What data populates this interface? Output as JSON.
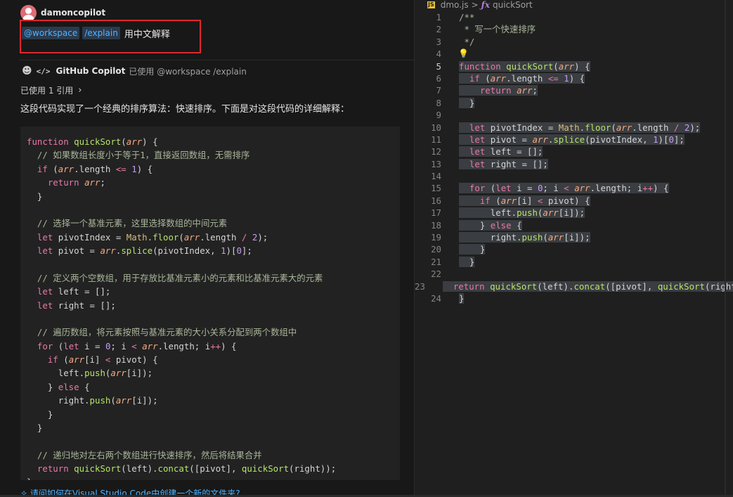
{
  "chat": {
    "user": {
      "name": "damoncopilot"
    },
    "message": {
      "agent": "@workspace",
      "command": "/explain",
      "text": "用中文解释"
    },
    "response": {
      "bot_name": "GitHub Copilot",
      "used": "已使用 @workspace /explain",
      "references": "已使用 1 引用",
      "intro": "这段代码实现了一个经典的排序算法：快速排序。下面是对这段代码的详细解释：",
      "code": [
        "function quickSort(arr) {",
        "  // 如果数组长度小于等于1，直接返回数组，无需排序",
        "  if (arr.length <= 1) {",
        "    return arr;",
        "  }",
        "",
        "  // 选择一个基准元素，这里选择数组的中间元素",
        "  let pivotIndex = Math.floor(arr.length / 2);",
        "  let pivot = arr.splice(pivotIndex, 1)[0];",
        "",
        "  // 定义两个空数组，用于存放比基准元素小的元素和比基准元素大的元素",
        "  let left = [];",
        "  let right = [];",
        "",
        "  // 遍历数组，将元素按照与基准元素的大小关系分配到两个数组中",
        "  for (let i = 0; i < arr.length; i++) {",
        "    if (arr[i] < pivot) {",
        "      left.push(arr[i]);",
        "    } else {",
        "      right.push(arr[i]);",
        "    }",
        "  }",
        "",
        "  // 递归地对左右两个数组进行快速排序，然后将结果合并",
        "  return quickSort(left).concat([pivot], quickSort(right));",
        "}"
      ]
    },
    "followup": "✧ 请问如何在Visual Studio Code中创建一个新的文件夹?"
  },
  "editor": {
    "breadcrumb": {
      "lang_badge": "JS",
      "file": "dmo.js",
      "separator": ">",
      "symbol_icon": "ƒx",
      "symbol": "quickSort"
    },
    "current_line": 5,
    "lines": [
      "/**",
      " * 写一个快速排序",
      " */",
      "",
      "function quickSort(arr) {",
      "  if (arr.length <= 1) {",
      "    return arr;",
      "  }",
      "",
      "  let pivotIndex = Math.floor(arr.length / 2);",
      "  let pivot = arr.splice(pivotIndex, 1)[0];",
      "  let left = [];",
      "  let right = [];",
      "",
      "  for (let i = 0; i < arr.length; i++) {",
      "    if (arr[i] < pivot) {",
      "      left.push(arr[i]);",
      "    } else {",
      "      right.push(arr[i]);",
      "    }",
      "  }",
      "",
      "  return quickSort(left).concat([pivot], quickSort(right));",
      "}"
    ]
  },
  "colors": {
    "highlight_border": "#e0262d",
    "chip_text": "#4fb3ff",
    "keyword": "#e879a8",
    "function": "#b5e36a",
    "param": "#f5a97f",
    "number": "#c49bf5",
    "comment": "#a9b69a"
  }
}
